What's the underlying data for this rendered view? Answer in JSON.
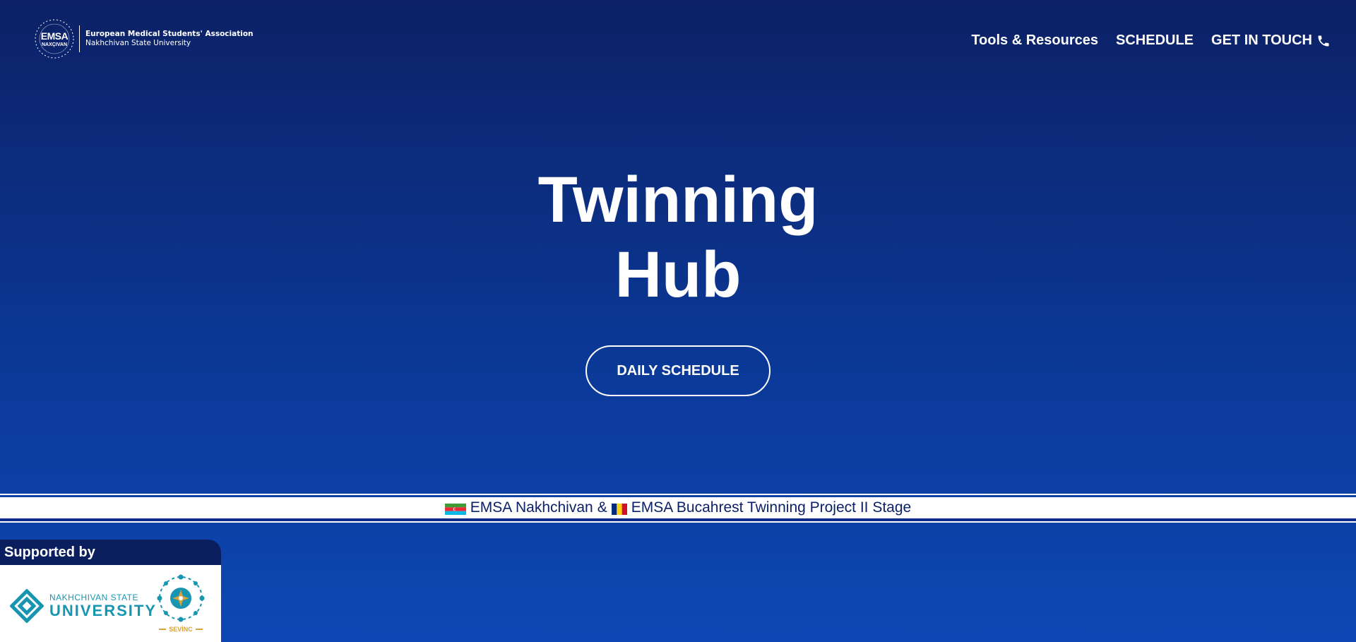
{
  "brand": {
    "seal_main": "EMSA",
    "seal_sub": "NAXÇIVAN",
    "title": "European Medical Students' Association",
    "subtitle": "Nakhchivan State University"
  },
  "nav": {
    "items": [
      {
        "label": "Tools & Resources"
      },
      {
        "label": "SCHEDULE"
      },
      {
        "label": "GET IN TOUCH",
        "icon": "phone-icon"
      }
    ]
  },
  "hero": {
    "title_line1": "Twinning",
    "title_line2": "Hub",
    "cta_label": "DAILY SCHEDULE"
  },
  "ticker": {
    "part1": "EMSA Nakhchivan",
    "separator": "&",
    "part2": "EMSA Bucahrest Twinning Project II Stage",
    "flag1": "azerbaijan-flag",
    "flag2": "romania-flag"
  },
  "support": {
    "heading": "Supported by",
    "logo1_line1": "NAKHCHIVAN STATE",
    "logo1_line2": "UNIVERSITY",
    "logo2_word": "SEVİNC"
  },
  "colors": {
    "bg_top": "#0c2166",
    "bg_bottom": "#0e47b4",
    "panel_header": "#0b1e5e",
    "nsu_teal": "#1895b0",
    "sevinc_gold": "#d8a23a"
  }
}
